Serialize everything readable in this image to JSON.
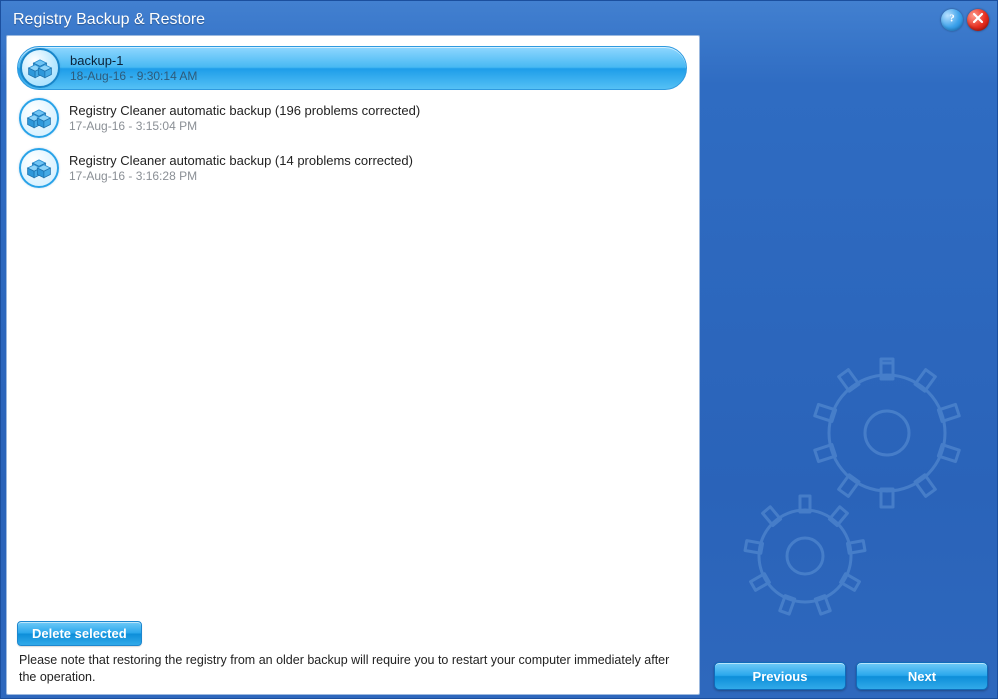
{
  "window": {
    "title": "Registry Backup & Restore"
  },
  "backups": [
    {
      "title": "backup-1",
      "time": "18-Aug-16 - 9:30:14 AM",
      "selected": true
    },
    {
      "title": "Registry Cleaner automatic backup (196 problems corrected)",
      "time": "17-Aug-16 - 3:15:04 PM",
      "selected": false
    },
    {
      "title": "Registry Cleaner automatic backup (14 problems corrected)",
      "time": "17-Aug-16 - 3:16:28 PM",
      "selected": false
    }
  ],
  "actions": {
    "delete_label": "Delete selected",
    "previous_label": "Previous",
    "next_label": "Next"
  },
  "note_text": "Please note that restoring the registry from an older backup will require you to restart your computer immediately after the operation.",
  "icons": {
    "help": "help-icon",
    "close": "close-icon",
    "boxes": "boxes-icon",
    "gear": "gear-icon"
  }
}
